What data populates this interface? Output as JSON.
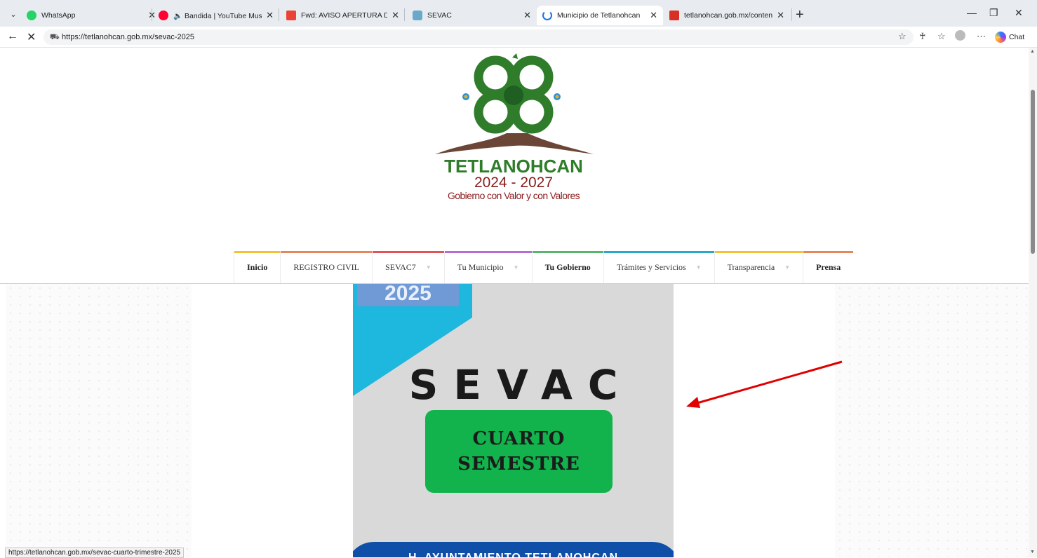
{
  "browser": {
    "tabs": [
      {
        "label": "WhatsApp",
        "icon": "whatsapp-icon",
        "color": "#25d366"
      },
      {
        "label": "🔈 Bandida | YouTube Music",
        "icon": "youtube-music-icon",
        "color": "#ff0033"
      },
      {
        "label": "Fwd: AVISO APERTURA DE PLATAF",
        "icon": "gmail-icon",
        "color": "#ea4335"
      },
      {
        "label": "SEVAC",
        "icon": "sevac-icon",
        "color": "#6aa9c9"
      },
      {
        "label": "Municipio de Tetlanohcan",
        "icon": "loading-icon",
        "color": "#1a73e8"
      },
      {
        "label": "tetlanohcan.gob.mx/contenidos/te",
        "icon": "pdf-icon",
        "color": "#d93025"
      }
    ],
    "active_tab_index": 4,
    "url": "https://tetlanohcan.gob.mx/sevac-2025",
    "chat_label": "Chat",
    "status_url": "https://tetlanohcan.gob.mx/sevac-cuarto-trimestre-2025"
  },
  "site": {
    "logo": {
      "name": "TETLANOHCAN",
      "years": "2024 - 2027",
      "slogan": "Gobierno con Valor y con Valores",
      "colors": {
        "green": "#2f7d2a",
        "darkgreen": "#1f5f22",
        "maroon": "#8a1c1c",
        "mountain": "#6b4636"
      }
    },
    "nav": [
      {
        "label": "Inicio",
        "bold": true,
        "caret": false,
        "color": "#f2c230"
      },
      {
        "label": "REGISTRO CIVIL",
        "bold": false,
        "caret": false,
        "color": "#e8865b"
      },
      {
        "label": "SEVAC7",
        "bold": false,
        "caret": true,
        "color": "#e2545a"
      },
      {
        "label": "Tu Municipio",
        "bold": false,
        "caret": true,
        "color": "#b66bd9"
      },
      {
        "label": "Tu Gobierno",
        "bold": true,
        "caret": false,
        "color": "#58b66b"
      },
      {
        "label": "Trámites y Servicios",
        "bold": false,
        "caret": true,
        "color": "#29a9c9"
      },
      {
        "label": "Transparencia",
        "bold": false,
        "caret": true,
        "color": "#f2c230"
      },
      {
        "label": "Prensa",
        "bold": true,
        "caret": false,
        "color": "#e8865b"
      }
    ]
  },
  "poster": {
    "year": "2025",
    "title": "SEVAC",
    "box_line1": "CUARTO",
    "box_line2": "SEMESTRE",
    "footer": "H. AYUNTAMIENTO TETLANOHCAN",
    "colors": {
      "bg": "#d9d9d9",
      "cyan": "#1eb7de",
      "green": "#12b24d",
      "blue": "#0f4fa8"
    }
  },
  "annotation": {
    "arrow_color": "#e00000"
  }
}
